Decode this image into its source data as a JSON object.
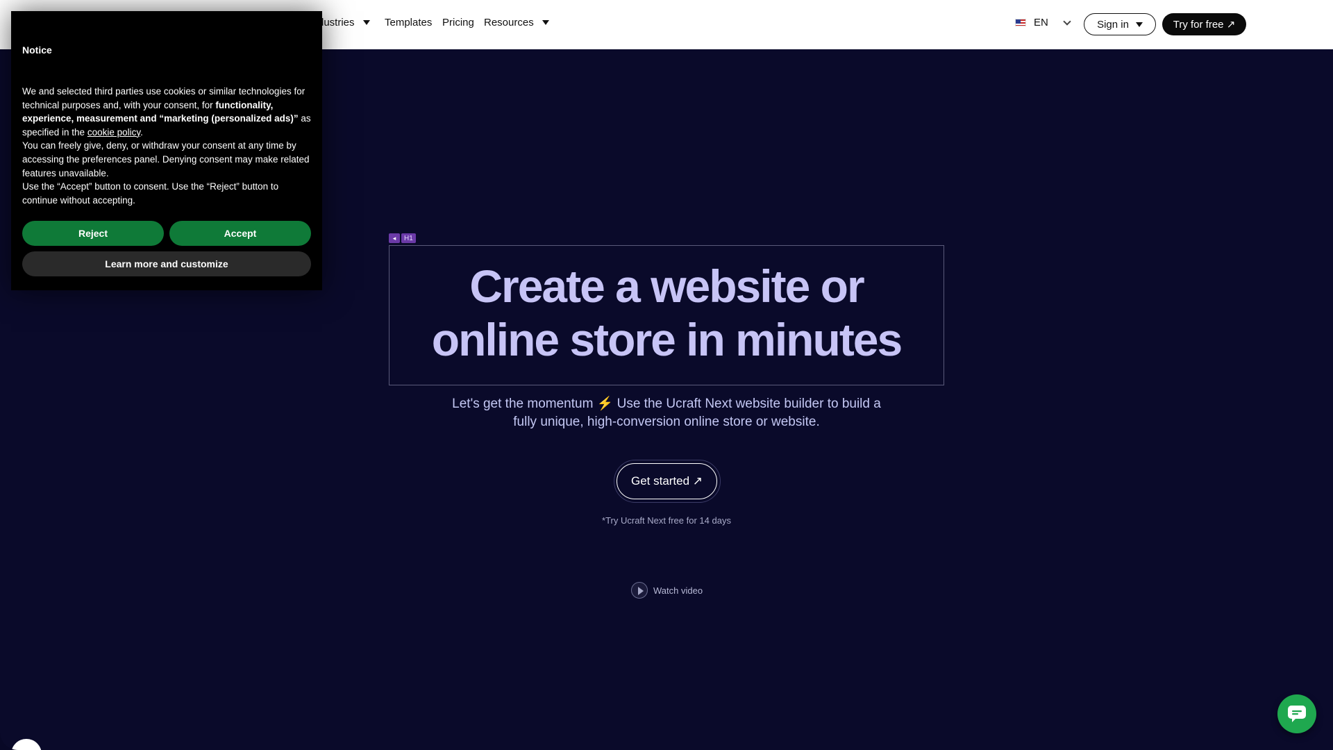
{
  "header": {
    "nav": [
      {
        "label": "dustries",
        "has_caret": true
      },
      {
        "label": "Templates",
        "has_caret": false
      },
      {
        "label": "Pricing",
        "has_caret": false
      },
      {
        "label": "Resources",
        "has_caret": true
      }
    ],
    "language": {
      "code": "EN",
      "flag_icon": "us-flag-icon"
    },
    "signin_label": "Sign in",
    "tryfree_label": "Try for free ↗"
  },
  "cookie_notice": {
    "title": "Notice",
    "paragraph1_a": "We and selected third parties use cookies or similar technologies for technical purposes and, with your consent, for ",
    "paragraph1_bold": "functionality, experience, measurement and “marketing (personalized ads)”",
    "paragraph1_b": " as specified in the ",
    "cookie_policy_link": "cookie policy",
    "paragraph1_end": ".",
    "paragraph2": "You can freely give, deny, or withdraw your consent at any time by accessing the preferences panel. Denying consent may make related features unavailable.",
    "paragraph3": "Use the “Accept” button to consent. Use the “Reject” button to continue without accepting.",
    "reject_label": "Reject",
    "accept_label": "Accept",
    "customize_label": "Learn more and customize",
    "accent_color": "#0f7a38"
  },
  "hero": {
    "badge_icon": "◂",
    "badge_tag": "H1",
    "title_line1": "Create a website or",
    "title_line2": "online store in minutes",
    "subtitle": "Let's get the momentum ⚡ Use the Ucraft Next website builder to build a fully unique, high-conversion online store or website.",
    "cta_label": "Get started ↗",
    "trial_note": "*Try Ucraft Next free for 14 days",
    "watch_video_label": "Watch video",
    "title_color": "#c7c4f6"
  },
  "chat": {
    "icon": "chat-icon",
    "color": "#1fa84f"
  }
}
